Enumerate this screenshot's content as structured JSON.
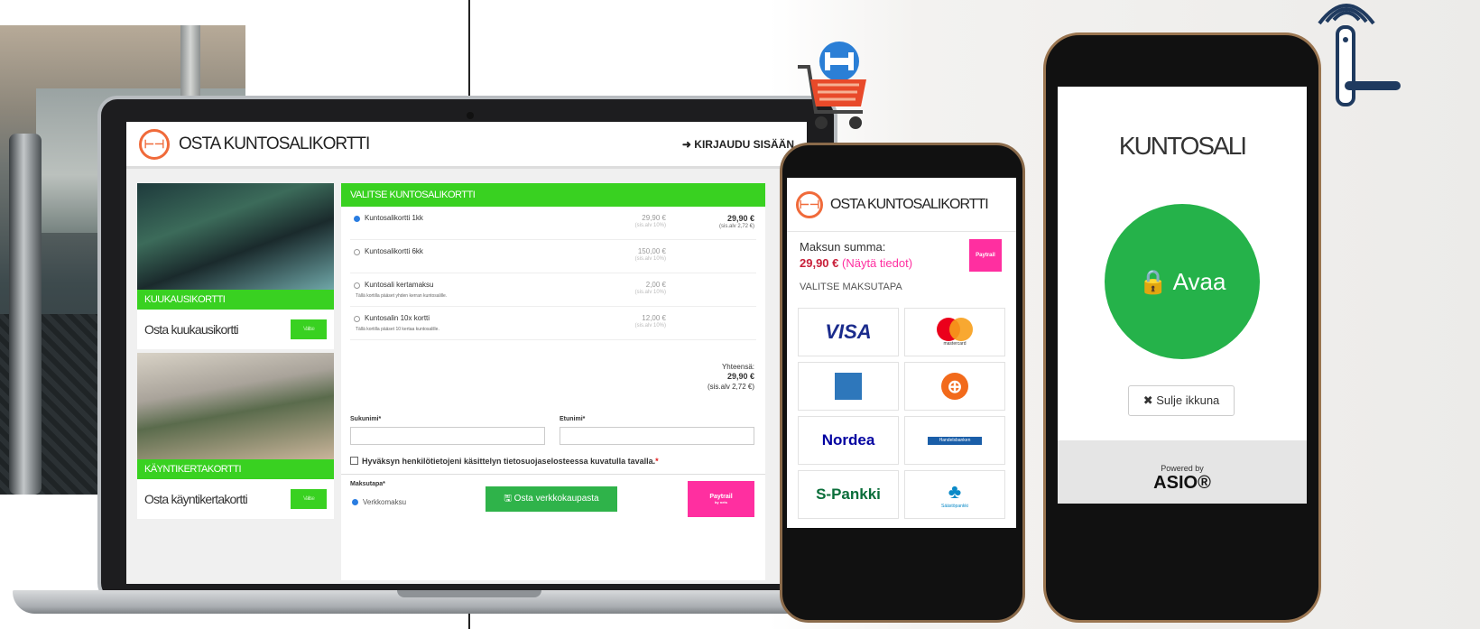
{
  "laptop": {
    "title": "OSTA KUNTOSALIKORTTI",
    "login": "➜ KIRJAUDU SISÄÄN",
    "cards": [
      {
        "label": "KUUKAUSIKORTTI",
        "body": "Osta kuukausikortti",
        "button": "Valitse"
      },
      {
        "label": "KÄYNTIKERTAKORTTI",
        "body": "Osta käyntikertakortti",
        "button": "Valitse"
      }
    ],
    "form": {
      "header": "VALITSE KUNTOSALIKORTTI",
      "rows": [
        {
          "name": "Kuntosalikortti 1kk",
          "sub": "",
          "price": "29,90 €",
          "alv": "(sis.alv 10%)",
          "total": "29,90 €",
          "total_alv": "(sis.alv 2,72 €)"
        },
        {
          "name": "Kuntosalikortti 6kk",
          "sub": "",
          "price": "150,00 €",
          "alv": "(sis.alv 10%)",
          "total": "",
          "total_alv": ""
        },
        {
          "name": "Kuntosali kertamaksu",
          "sub": "Tällä kortilla pääset yhden kerran kuntosalille.",
          "price": "2,00 €",
          "alv": "(sis.alv 10%)",
          "total": "",
          "total_alv": ""
        },
        {
          "name": "Kuntosalin 10x kortti",
          "sub": "Tällä kortilla pääset 10 kertaa kuntosalille.",
          "price": "12,00 €",
          "alv": "(sis.alv 10%)",
          "total": "",
          "total_alv": ""
        }
      ],
      "sum_label": "Yhteensä:",
      "sum_value": "29,90 €",
      "sum_alv": "(sis.alv 2,72 €)",
      "lastname_label": "Sukunimi*",
      "firstname_label": "Etunimi*",
      "consent": "Hyväksyn henkilötietojeni käsittelyn tietosuojaselosteessa kuvatulla tavalla.",
      "consent_required": "*",
      "payment_label": "Maksutapa*",
      "payment_option": "Verkkomaksu",
      "buy_button": "🖫 Osta verkkokaupasta"
    }
  },
  "paytrail": {
    "name": "Paytrail",
    "sub": "by nets"
  },
  "phone1": {
    "title": "OSTA KUNTOSALIKORTTI",
    "sum_label": "Maksun summa:",
    "amount": "29,90 €",
    "show_details": "(Näytä tiedot)",
    "method_title": "VALITSE MAKSUTAPA",
    "methods": {
      "visa": "VISA",
      "mastercard": "mastercard",
      "nordea": "Nordea",
      "handelsbanken": "Handelsbanken",
      "spankki": "S-Pankki",
      "saastopankki": "Säästöpankki"
    }
  },
  "phone2": {
    "title": "KUNTOSALI",
    "open_button": "🔒 Avaa",
    "close_button": "✖ Sulje ikkuna",
    "powered_by": "Powered by",
    "brand": "ASIO®"
  },
  "colors": {
    "accent_green": "#39d121",
    "button_green": "#25b24a",
    "logo_orange": "#f06a3a",
    "paytrail_pink": "#ff2fa0"
  }
}
